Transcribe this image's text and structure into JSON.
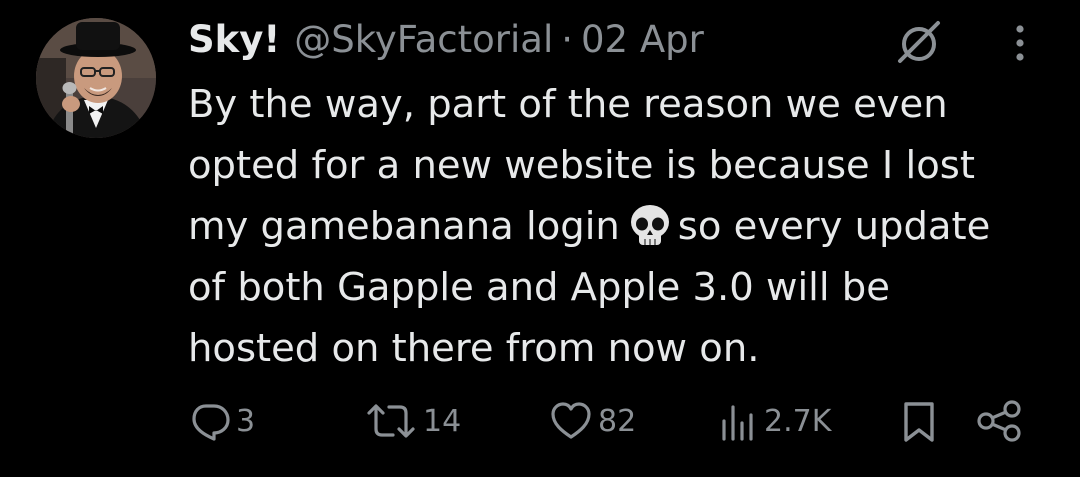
{
  "tweet": {
    "author_name": "Sky!",
    "author_handle": "@SkyFactorial",
    "separator": "·",
    "date": "02 Apr",
    "text_lines": {
      "l1": "By the way, part of the reason we even",
      "l2": "opted for a new website is because I lost",
      "l3a": "my gamebanana login",
      "l3b": "so every update",
      "l4": "of both Gapple and Apple 3.0 will be",
      "l5": "hosted on there from now on."
    },
    "emoji": "skull"
  },
  "actions": {
    "replies": "3",
    "reposts": "14",
    "likes": "82",
    "views": "2.7K"
  },
  "icons": {
    "grok": "grok-icon",
    "more": "more-options-icon",
    "reply": "reply-icon",
    "repost": "repost-icon",
    "like": "heart-icon",
    "views": "views-chart-icon",
    "bookmark": "bookmark-icon",
    "share": "share-icon"
  },
  "colors": {
    "background": "#000000",
    "primary_text": "#e7e9ea",
    "secondary_text": "#8b9095"
  }
}
